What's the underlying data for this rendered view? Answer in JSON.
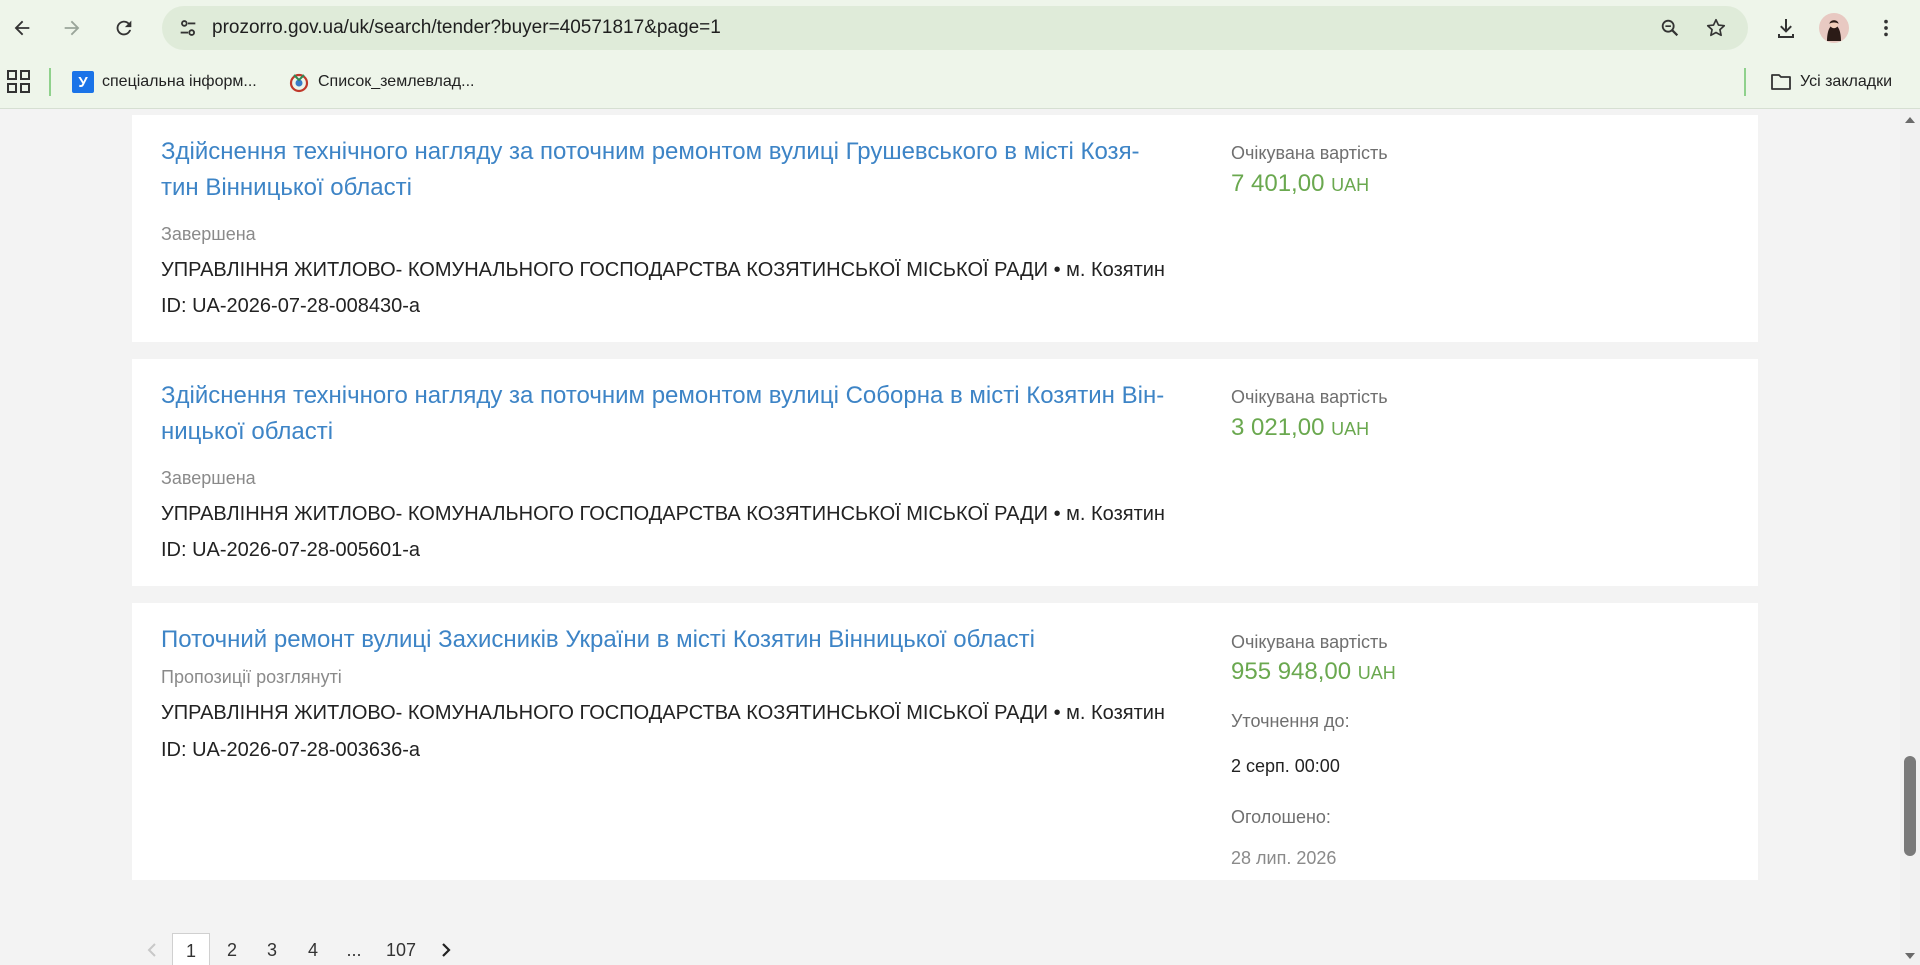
{
  "browser": {
    "url": "prozorro.gov.ua/uk/search/tender?buyer=40571817&page=1",
    "bookmarks": [
      {
        "label": "спеціальна інформ...",
        "icon": "u-favicon"
      },
      {
        "label": "Список_землевлад...",
        "icon": "wikimedia-favicon"
      }
    ],
    "all_bookmarks_label": "Усі закладки",
    "favicon_letter": "У"
  },
  "tenders": [
    {
      "title": "Здійснення технічного нагляду за поточним ремонтом вулиці Грушевського в місті Козя-тин Вінницької області",
      "status": "Завершена",
      "organization": "УПРАВЛІННЯ ЖИТЛОВО- КОМУНАЛЬНОГО ГОСПОДАРСТВА КОЗЯТИНСЬКОЇ МІСЬКОЇ РАДИ • м. Козятин",
      "id": "ID: UA-2026-07-28-008430-a",
      "value_label": "Очікувана вартість",
      "value": "7 401,00",
      "currency": "UAH"
    },
    {
      "title": "Здійснення технічного нагляду за поточним ремонтом вулиці Соборна в місті Козятин Він-ницької області",
      "status": "Завершена",
      "organization": "УПРАВЛІННЯ ЖИТЛОВО- КОМУНАЛЬНОГО ГОСПОДАРСТВА КОЗЯТИНСЬКОЇ МІСЬКОЇ РАДИ • м. Козятин",
      "id": "ID: UA-2026-07-28-005601-a",
      "value_label": "Очікувана вартість",
      "value": "3 021,00",
      "currency": "UAH"
    },
    {
      "title": "Поточний ремонт вулиці Захисників України в місті Козятин Вінницької області",
      "status": "Пропозиції розглянуті",
      "organization": "УПРАВЛІННЯ ЖИТЛОВО- КОМУНАЛЬНОГО ГОСПОДАРСТВА КОЗЯТИНСЬКОЇ МІСЬКОЇ РАДИ • м. Козятин",
      "id": "ID: UA-2026-07-28-003636-a",
      "value_label": "Очікувана вартість",
      "value": "955 948,00",
      "currency": "UAH",
      "clarify_label": "Уточнення до:",
      "clarify_date": "2 серп. 00:00",
      "announced_label": "Оголошено:",
      "announced_date": "28 лип. 2026"
    }
  ],
  "pagination": {
    "pages": [
      "1",
      "2",
      "3",
      "4",
      "...",
      "107"
    ],
    "current": "1"
  },
  "colors": {
    "link": "#3d84c6",
    "value": "#6aa84f",
    "chrome_bg": "#eef5ea"
  }
}
